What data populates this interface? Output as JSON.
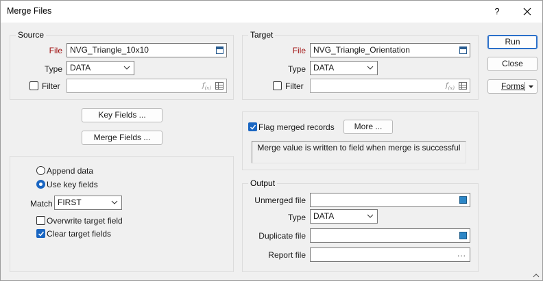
{
  "window": {
    "title": "Merge Files",
    "help": "?"
  },
  "source": {
    "title": "Source",
    "file_label": "File",
    "file_value": "NVG_Triangle_10x10",
    "type_label": "Type",
    "type_value": "DATA",
    "filter_label": "Filter",
    "filter_checked": false
  },
  "target": {
    "title": "Target",
    "file_label": "File",
    "file_value": "NVG_Triangle_Orientation",
    "type_label": "Type",
    "type_value": "DATA",
    "filter_label": "Filter",
    "filter_checked": false
  },
  "buttons": {
    "run": "Run",
    "close": "Close",
    "forms": "Forms",
    "key_fields": "Key Fields ...",
    "merge_fields": "Merge Fields ...",
    "more": "More ..."
  },
  "options": {
    "append_data": "Append data",
    "use_key_fields": "Use key fields",
    "selected_mode": "use_key_fields",
    "match_label": "Match",
    "match_value": "FIRST",
    "overwrite_label": "Overwrite target field",
    "overwrite_checked": false,
    "clear_label": "Clear target fields",
    "clear_checked": true
  },
  "flag": {
    "label": "Flag merged records",
    "checked": true,
    "message": "Merge value is written to field when merge is successful"
  },
  "output": {
    "title": "Output",
    "unmerged_label": "Unmerged file",
    "unmerged_value": "",
    "type_label": "Type",
    "type_value": "DATA",
    "duplicate_label": "Duplicate file",
    "duplicate_value": "",
    "report_label": "Report file",
    "report_value": "",
    "report_browse": "..."
  },
  "icons": {
    "browse": "table-browse-icon",
    "expression": "fx",
    "colors": {
      "accent": "#1a66c2",
      "required_label": "#a01010"
    }
  }
}
